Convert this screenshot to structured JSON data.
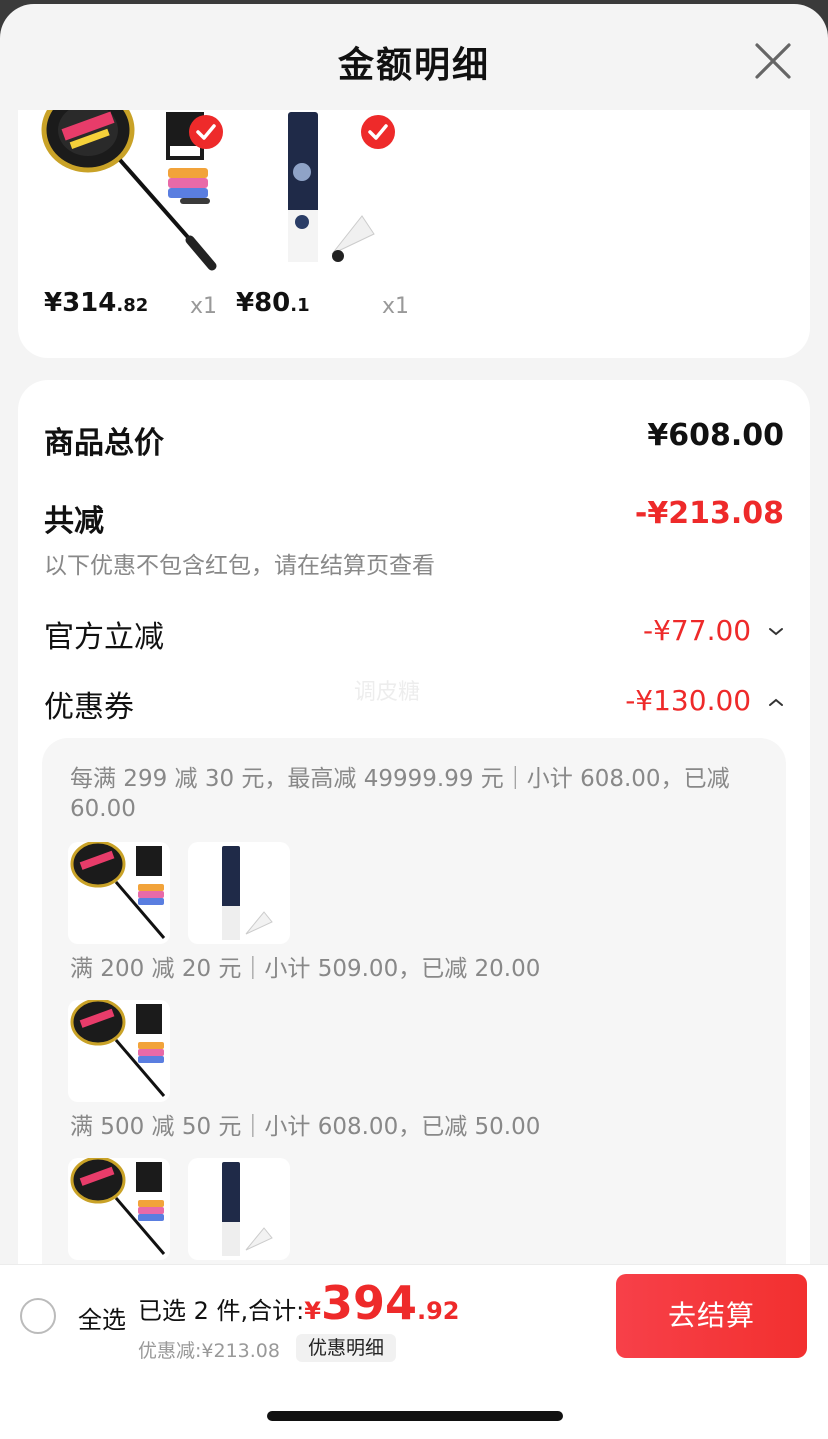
{
  "sheet": {
    "title": "金额明细"
  },
  "products": [
    {
      "price_int": "¥314",
      "price_dec": ".82",
      "qty": "x1",
      "image": "badminton-racket-set",
      "checked": true
    },
    {
      "price_int": "¥80",
      "price_dec": ".1",
      "qty": "x1",
      "image": "shuttlecock-tube",
      "checked": true
    }
  ],
  "summary": {
    "total_label": "商品总价",
    "total_value": "¥608.00",
    "reduce_label": "共减",
    "reduce_value": "-¥213.08",
    "note": "以下优惠不包含红包，请在结算页查看",
    "official_label": "官方立减",
    "official_value": "-¥77.00",
    "coupon_label": "优惠券",
    "coupon_value": "-¥130.00"
  },
  "watermark": "调皮糖",
  "coupon_rules": [
    {
      "line1": "每满 299 减 30 元，最高减 49999.99 元｜小计 608.00，已减",
      "line2": "60.00",
      "items": [
        "badminton-racket-set",
        "shuttlecock-tube"
      ]
    },
    {
      "line1": "满 200 减 20 元｜小计 509.00，已减 20.00",
      "items": [
        "badminton-racket-set"
      ]
    },
    {
      "line1": "满 500 减 50 元｜小计 608.00，已减 50.00",
      "items": [
        "badminton-racket-set",
        "shuttlecock-tube"
      ]
    }
  ],
  "bottom_bar": {
    "select_all": "全选",
    "selected_text": "已选 2 件,合计:",
    "currency": "¥",
    "total_int": "394",
    "total_dec": ".92",
    "discount_text": "优惠减:¥213.08",
    "detail_chip": "优惠明细",
    "checkout": "去结算"
  },
  "colors": {
    "accent_red": "#ee2a2a",
    "sheet_bg": "#f4f4f4",
    "card_bg": "#ffffff"
  }
}
